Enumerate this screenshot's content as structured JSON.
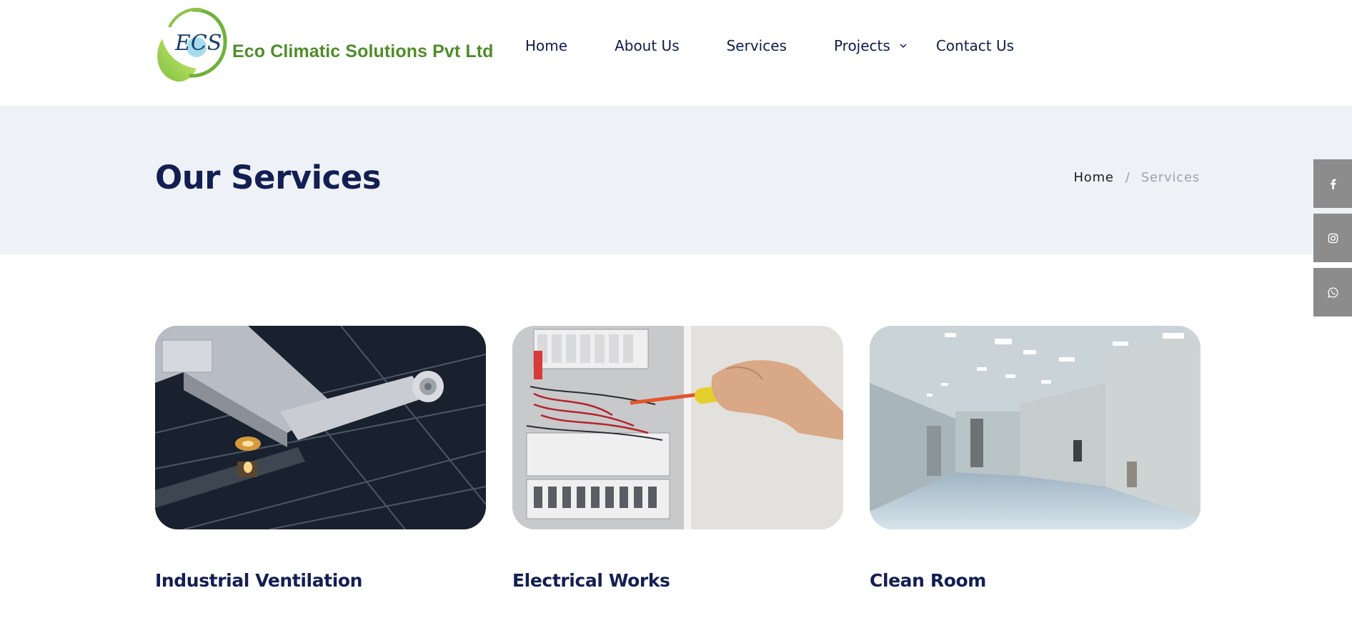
{
  "header": {
    "logo_text": "Eco Climatic Solutions Pvt Ltd",
    "logo_monogram": "ECS",
    "nav": [
      {
        "label": "Home"
      },
      {
        "label": "About Us"
      },
      {
        "label": "Services"
      },
      {
        "label": "Projects",
        "icon": "chevron-down-icon"
      },
      {
        "label": "Contact Us"
      }
    ]
  },
  "banner": {
    "title": "Our Services",
    "breadcrumb": {
      "home": "Home",
      "separator": "/",
      "current": "Services"
    }
  },
  "social": [
    {
      "name": "facebook-icon"
    },
    {
      "name": "instagram-icon"
    },
    {
      "name": "whatsapp-icon"
    }
  ],
  "services": [
    {
      "title": "Industrial Ventilation",
      "image": "industrial ductwork ceiling photo"
    },
    {
      "title": "Electrical Works",
      "image": "electrical panel with screwdriver photo"
    },
    {
      "title": "Clean Room",
      "image": "clean room corridor photo"
    }
  ],
  "colors": {
    "brand_green": "#4f8d2a",
    "navy_text": "#131f52",
    "banner_bg": "#eef2f7",
    "social_bg": "#8c8c8c"
  }
}
